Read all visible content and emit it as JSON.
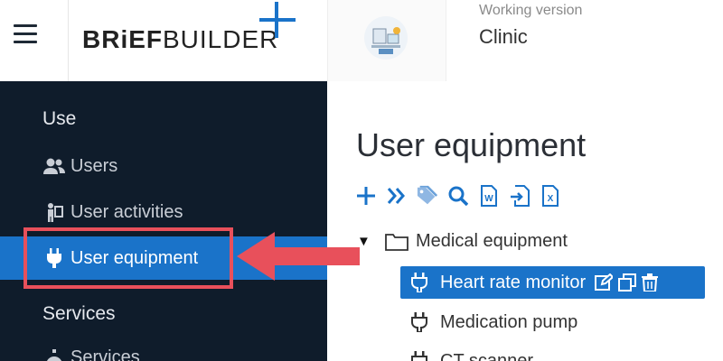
{
  "header": {
    "logo_text_bold": "BRiEF",
    "logo_text_light": "BUILDER",
    "working_version_label": "Working version",
    "project_name": "Clinic"
  },
  "sidebar": {
    "section_use": "Use",
    "items_use": [
      {
        "label": "Users",
        "icon": "users-icon"
      },
      {
        "label": "User activities",
        "icon": "user-activities-icon"
      },
      {
        "label": "User equipment",
        "icon": "plug-icon",
        "active": true
      }
    ],
    "section_services": "Services",
    "items_services": [
      {
        "label": "Services",
        "icon": "services-icon"
      }
    ]
  },
  "main": {
    "title": "User equipment",
    "toolbar": [
      "add-icon",
      "expand-all-icon",
      "tags-icon",
      "search-icon",
      "word-export-icon",
      "import-icon",
      "excel-export-icon"
    ],
    "tree": {
      "folder": "Medical equipment",
      "items": [
        {
          "label": "Heart rate monitor",
          "selected": true
        },
        {
          "label": "Medication pump"
        },
        {
          "label": "CT scanner"
        }
      ]
    }
  },
  "colors": {
    "sidebar_bg": "#0f1c2b",
    "accent": "#1a73c9",
    "highlight": "#e8505b"
  }
}
